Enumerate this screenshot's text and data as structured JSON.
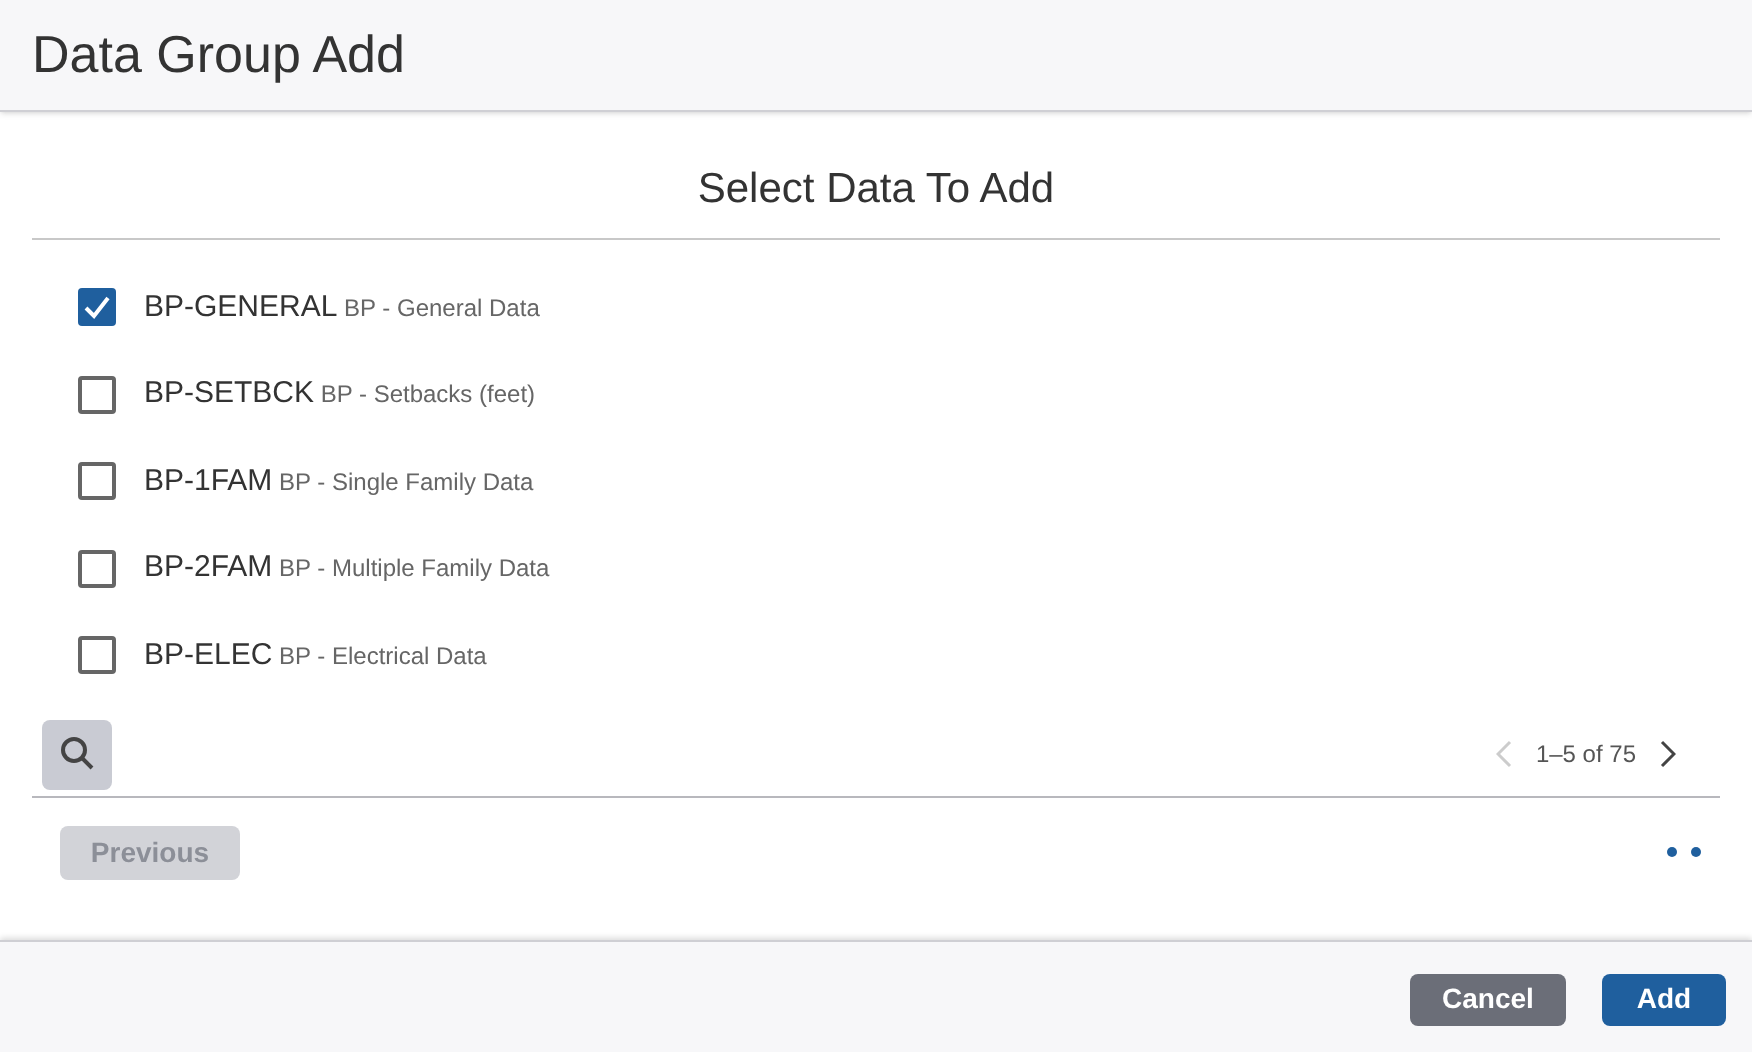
{
  "window": {
    "title": "Data Group Add"
  },
  "heading": "Select Data To Add",
  "items": [
    {
      "code": "BP-GENERAL",
      "description": "BP - General Data",
      "checked": true
    },
    {
      "code": "BP-SETBCK",
      "description": "BP - Setbacks (feet)",
      "checked": false
    },
    {
      "code": "BP-1FAM",
      "description": "BP - Single Family Data",
      "checked": false
    },
    {
      "code": "BP-2FAM",
      "description": "BP - Multiple Family Data",
      "checked": false
    },
    {
      "code": "BP-ELEC",
      "description": "BP - Electrical Data",
      "checked": false
    }
  ],
  "pager": {
    "label": "1–5 of 75",
    "prev_disabled": true,
    "next_disabled": false
  },
  "previous_button": {
    "label": "Previous",
    "disabled": true
  },
  "buttons": [
    {
      "label": "Cancel",
      "kind": "secondary"
    },
    {
      "label": "Add",
      "kind": "primary"
    }
  ]
}
